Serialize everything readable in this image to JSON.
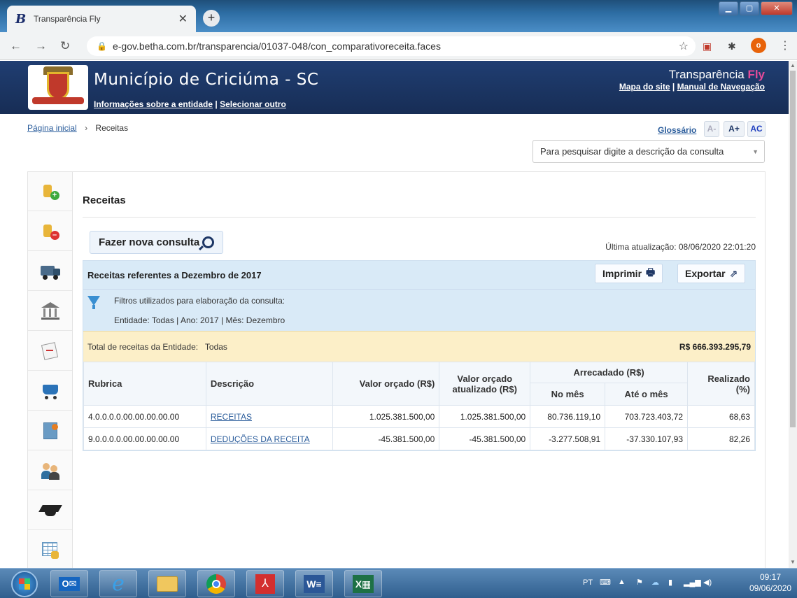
{
  "browser": {
    "tab_title": "Transparência Fly",
    "tab_logo": "B",
    "url": "e-gov.betha.com.br/transparencia/01037-048/con_comparativoreceita.faces",
    "profile_initial": "o"
  },
  "header": {
    "municipality": "Município de Criciúma - SC",
    "entity_info_link": "Informações sobre a entidade",
    "select_other_link": "Selecionar outro",
    "link_separator": "|",
    "brand_prefix": "Transparência",
    "brand_suffix": "Fly",
    "sitemap_link": "Mapa do site",
    "manual_link": "Manual de Navegação"
  },
  "breadcrumb": {
    "home": "Página inicial",
    "separator": "›",
    "current": "Receitas"
  },
  "tools": {
    "glossary": "Glossário",
    "font_decrease": "A-",
    "font_increase": "A+",
    "contrast": "AC",
    "search_placeholder": "Para pesquisar digite a descrição da consulta"
  },
  "main": {
    "title": "Receitas",
    "new_query_button": "Fazer nova consulta",
    "last_update": "Última atualização: 08/06/2020 22:01:20",
    "panel_title": "Receitas referentes a Dezembro de 2017",
    "print_button": "Imprimir",
    "export_button": "Exportar",
    "filters_label": "Filtros utilizados para elaboração da consulta:",
    "filters_value": "Entidade: Todas | Ano: 2017 | Mês: Dezembro",
    "total_label": "Total de receitas da Entidade:   Todas",
    "total_value": "R$ 666.393.295,79"
  },
  "table": {
    "headers": {
      "rubrica": "Rubrica",
      "descricao": "Descrição",
      "valor_orcado": "Valor orçado (R$)",
      "valor_atualizado": "Valor orçado atualizado (R$)",
      "arrecadado": "Arrecadado (R$)",
      "no_mes": "No mês",
      "ate_mes": "Até o mês",
      "realizado": "Realizado (%)"
    },
    "rows": [
      {
        "rubrica": "4.0.0.0.0.00.00.00.00.00",
        "descricao": "RECEITAS",
        "valor_orcado": "1.025.381.500,00",
        "valor_atualizado": "1.025.381.500,00",
        "no_mes": "80.736.119,10",
        "ate_mes": "703.723.403,72",
        "realizado": "68,63"
      },
      {
        "rubrica": "9.0.0.0.0.00.00.00.00.00",
        "descricao": "DEDUÇÕES DA RECEITA",
        "valor_orcado": "-45.381.500,00",
        "valor_atualizado": "-45.381.500,00",
        "no_mes": "-3.277.508,91",
        "ate_mes": "-37.330.107,93",
        "realizado": "82,26"
      }
    ]
  },
  "sidebar_icons": [
    "coins-add-icon",
    "coins-remove-icon",
    "truck-icon",
    "bank-icon",
    "document-edit-icon",
    "shopping-cart-icon",
    "certificate-icon",
    "people-icon",
    "graduation-cap-icon",
    "spreadsheet-coins-icon"
  ],
  "taskbar": {
    "language": "PT",
    "time": "09:17",
    "date": "09/06/2020"
  }
}
